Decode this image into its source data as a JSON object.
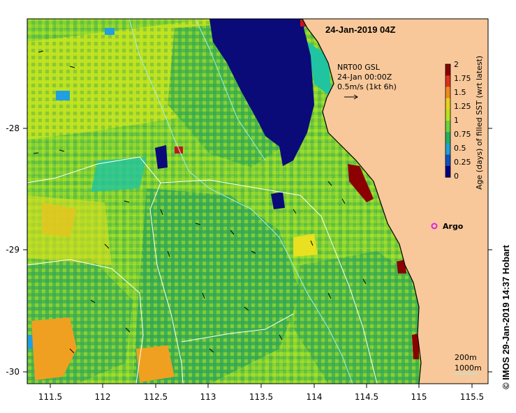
{
  "map": {
    "title": "24-Jan-2019 04Z",
    "credit": "© IMOS 29-Jan-2019 14:37 Hobart",
    "lon_ticks": [
      "111.5",
      "112",
      "112.5",
      "113",
      "113.5",
      "114",
      "114.5",
      "115",
      "115.5"
    ],
    "lat_ticks": [
      "-28",
      "-29",
      "-30"
    ],
    "current": {
      "line1": "NRT00 GSL",
      "line2": "24-Jan 00:00Z",
      "line3": "0.5m/s (1kt 6h)"
    },
    "argo_label": "Argo",
    "contours": {
      "line1": "200m",
      "line2": "1000m"
    },
    "colorbar": {
      "label": "Age (days) of filled SST (wrt latest)",
      "ticks": [
        "2",
        "1.75",
        "1.5",
        "1.25",
        "1",
        "0.75",
        "0.5",
        "0.25",
        "0"
      ],
      "colors": [
        "#8b0000",
        "#e0301e",
        "#f08b1e",
        "#e8d020",
        "#b8e020",
        "#6cd03c",
        "#20b060",
        "#20a0d0",
        "#1050c0",
        "#000080"
      ]
    },
    "colors": {
      "land": "#f8c89a",
      "deep_water": "#0a0a78",
      "shelf_contour": "#a0f0f0",
      "deep_contour": "#ffffff",
      "argo": "#e020e0"
    }
  }
}
